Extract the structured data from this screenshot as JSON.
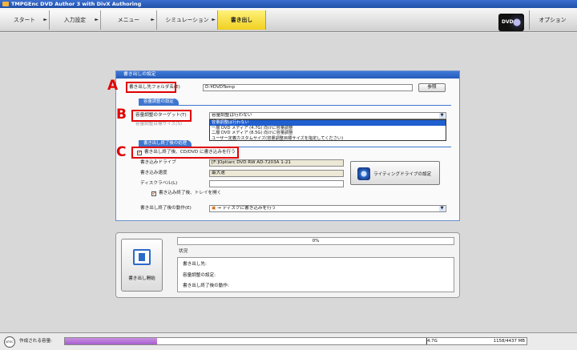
{
  "window": {
    "title": "TMPGEnc DVD Author 3 with DivX Authoring"
  },
  "nav": {
    "steps": [
      {
        "label": "スタート"
      },
      {
        "label": "入力設定"
      },
      {
        "label": "メニュー"
      },
      {
        "label": "シミュレーション"
      },
      {
        "label": "書き出し"
      }
    ],
    "active_step": "書き出し",
    "dvd_logo": "DVD",
    "options_label": "オプション"
  },
  "panel": {
    "title": "書き出しの設定",
    "output_folder_label": "書き出し先フォルダ名(E)",
    "output_folder_value": "D:¥DVDTemp",
    "browse_label": "参照",
    "capacity_section": "容量調整の設定",
    "target_label": "容量調整のターゲット(T)",
    "target_value": "容量調整は行わない",
    "target_size_label": "容量調整目標サイズ(S)",
    "target_options": [
      "容量調整は行わない",
      "一層 DVD メディア (4.7G) 向けに容量調整",
      "二層 DVD メディア (8.5G) 向けに容量調整",
      "ユーザー定義カスタムサイズ(容量調整目標サイズを指定してください)"
    ],
    "after_write_section": "書き出し終了後の処理",
    "burn_check_label": "書き出し終了後、CD/DVD に書き込みを行う",
    "burn_checked": true,
    "drive_label": "書き込みドライブ",
    "drive_value": "[F:]Optiarc  DVD RW AD-7203A  1-21",
    "speed_label": "書き込み速度",
    "speed_value": "最大速",
    "disc_label_label": "ディスクラベル(L)",
    "disc_label_value": "",
    "eject_label": "書き込み終了後、トレイを開く",
    "eject_checked": true,
    "drive_settings_label": "ライティングドライブの設定",
    "after_action_label": "書き出し終了後の動作(E)",
    "after_action_value": "→ ディスクに書き込みを行う"
  },
  "markers": {
    "a": "A",
    "b": "B",
    "c": "C"
  },
  "encode": {
    "start_label": "書き出し開始",
    "progress_text": "0%",
    "status_title": "状況",
    "status_lines": [
      "書き出し先:",
      "容量調整の設定:",
      "書き出し終了後の動作:"
    ]
  },
  "statusbar": {
    "ntsc": "NTSC",
    "capacity_label": "作成される容量:",
    "capacity_fraction": 0.2,
    "limit_label": "4.7G",
    "capacity_readout": "1158/4437 MB"
  },
  "colors": {
    "accent": "#3f77d0",
    "active_step": "#f3d63a",
    "annotation": "#e00000",
    "capacity_fill": "#b274d8"
  }
}
